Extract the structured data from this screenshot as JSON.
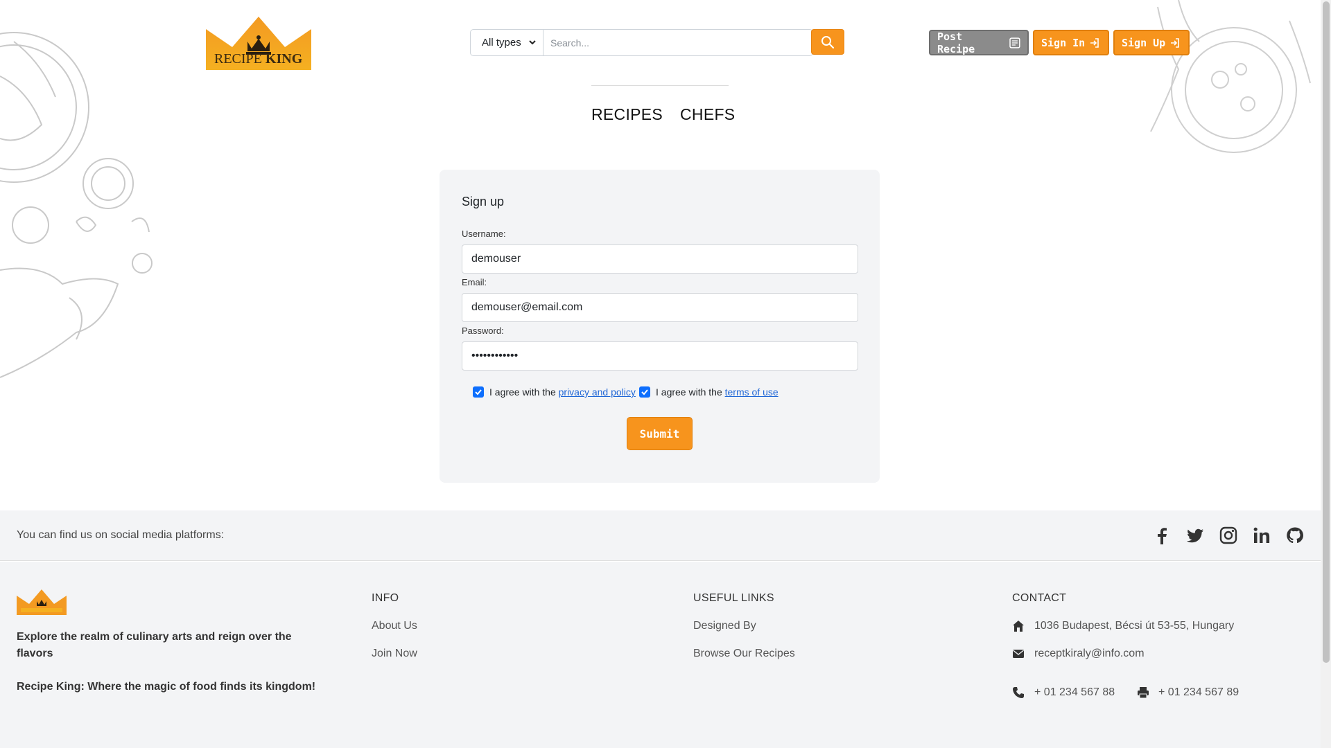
{
  "colors": {
    "accent": "#f7941d",
    "grey_button": "#8b8b8b",
    "checkbox": "#0d6efd",
    "link": "#1f66d6",
    "panel": "#f3f4f6"
  },
  "header": {
    "logo_text_recipe": "RECIPE",
    "logo_text_king": "KING",
    "search": {
      "type_selected": "All types",
      "placeholder": "Search..."
    },
    "post_recipe": "Post Recipe",
    "sign_in": "Sign In",
    "sign_up": "Sign Up"
  },
  "nav": {
    "recipes": "RECIPES",
    "chefs": "CHEFS"
  },
  "form": {
    "title": "Sign up",
    "username_label": "Username:",
    "username_value": "demouser",
    "email_label": "Email:",
    "email_value": "demouser@email.com",
    "password_label": "Password:",
    "password_value": "••••••••••••",
    "agree_prefix": "I agree with the",
    "privacy_link": "privacy and policy",
    "terms_link": "terms of use",
    "privacy_checked": true,
    "terms_checked": true,
    "submit": "Submit"
  },
  "footer": {
    "social_text": "You can find us on social media platforms:",
    "social_icons": [
      "facebook-icon",
      "twitter-icon",
      "instagram-icon",
      "linkedin-icon",
      "github-icon"
    ],
    "tagline1": "Explore the realm of culinary arts and reign over the flavors",
    "tagline2": "Recipe King: Where the magic of food finds its kingdom!",
    "info_head": "INFO",
    "info_links": [
      "About Us",
      "Join Now"
    ],
    "useful_head": "USEFUL LINKS",
    "useful_links": [
      "Designed By",
      "Browse Our Recipes"
    ],
    "contact_head": "CONTACT",
    "address": "1036 Budapest, Bécsi út 53-55, Hungary",
    "email": "receptkiraly@info.com",
    "phone": "+ 01 234 567 88",
    "fax": "+ 01 234 567 89"
  }
}
